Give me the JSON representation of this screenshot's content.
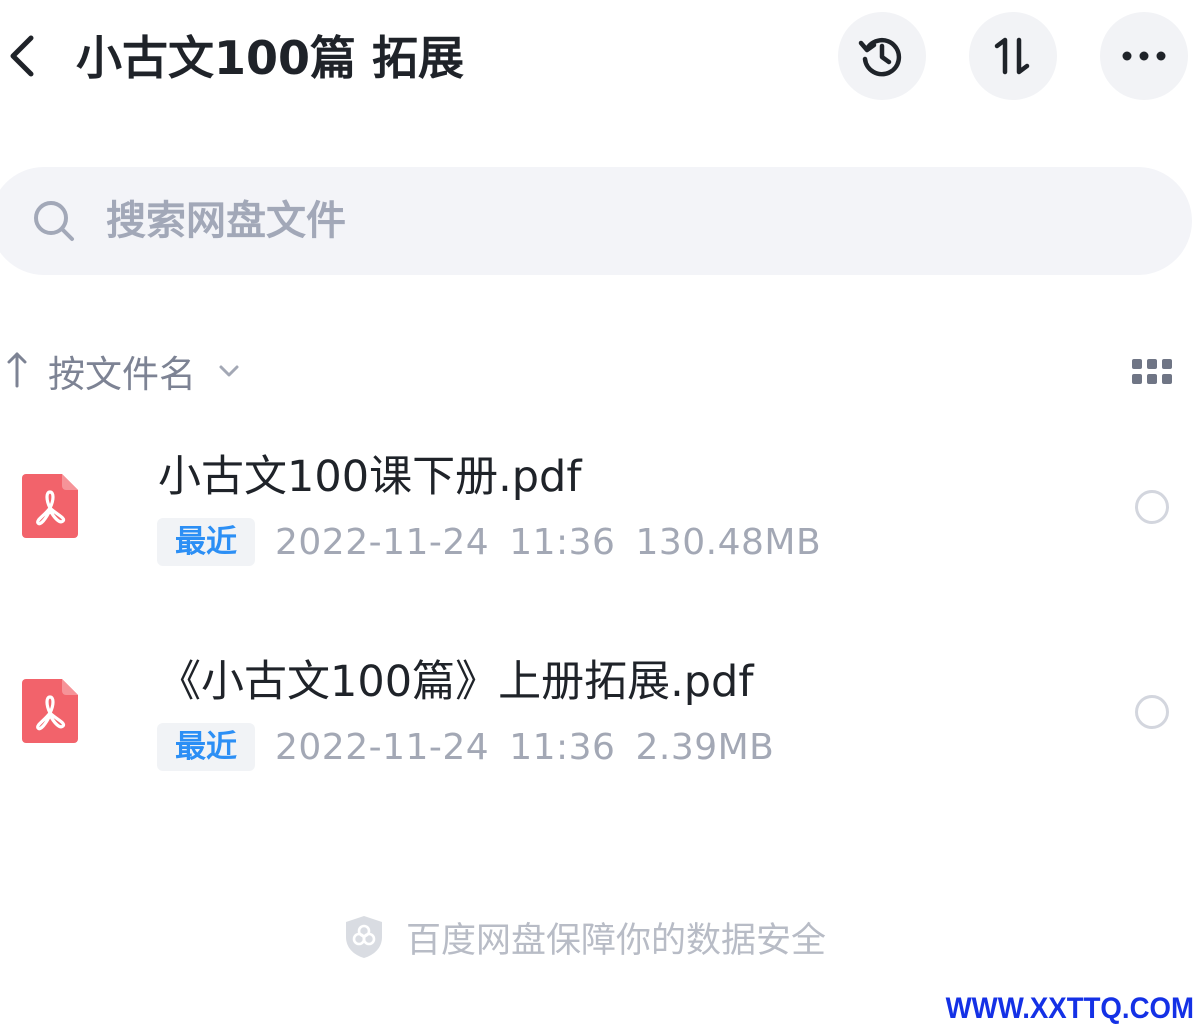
{
  "header": {
    "title": "小古文100篇 拓展",
    "back_icon": "chevron-left-icon",
    "actions": [
      {
        "name": "history",
        "icon": "history-clock-icon"
      },
      {
        "name": "sort-toggle",
        "icon": "sort-arrows-icon"
      },
      {
        "name": "more",
        "icon": "more-dots-icon"
      }
    ]
  },
  "search": {
    "placeholder": "搜索网盘文件",
    "icon": "search-icon"
  },
  "sort": {
    "direction_icon": "arrow-up-icon",
    "label": "按文件名",
    "dropdown_icon": "chevron-down-icon",
    "view_toggle_icon": "grid-view-icon"
  },
  "files": [
    {
      "icon": "pdf-file-icon",
      "name": "小古文100课下册.pdf",
      "badge": "最近",
      "date": "2022-11-24",
      "time": "11:36",
      "size": "130.48MB",
      "selected": false
    },
    {
      "icon": "pdf-file-icon",
      "name": "《小古文100篇》上册拓展.pdf",
      "badge": "最近",
      "date": "2022-11-24",
      "time": "11:36",
      "size": "2.39MB",
      "selected": false
    }
  ],
  "footer": {
    "security_text": "百度网盘保障你的数据安全",
    "shield_icon": "shield-icon"
  },
  "watermark": "WWW.XXTTQ.COM",
  "colors": {
    "title": "#1f2329",
    "badge_text": "#2c8ff5",
    "meta_text": "#a3a8b5",
    "pdf_icon": "#f2636b",
    "button_bg": "#f2f3f6",
    "search_bg": "#f3f4f8",
    "watermark": "#1431e6"
  }
}
